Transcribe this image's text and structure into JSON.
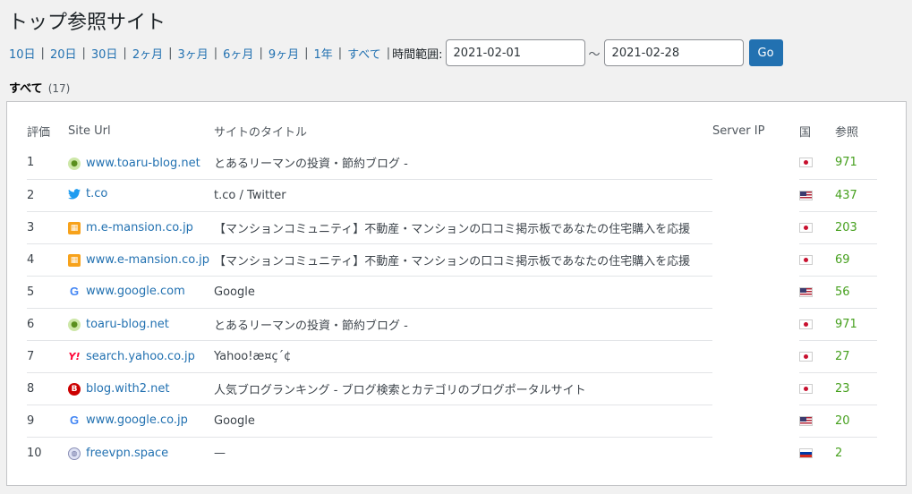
{
  "page_title": "トップ参照サイト",
  "filters": [
    {
      "label": "10日"
    },
    {
      "label": "20日"
    },
    {
      "label": "30日"
    },
    {
      "label": "2ヶ月"
    },
    {
      "label": "3ヶ月"
    },
    {
      "label": "6ヶ月"
    },
    {
      "label": "9ヶ月"
    },
    {
      "label": "1年"
    },
    {
      "label": "すべて"
    }
  ],
  "range_label": "時間範囲:",
  "date_from": "2021-02-01",
  "date_to": "2021-02-28",
  "tilde": "～",
  "go_label": "Go",
  "subsub": {
    "label": "すべて",
    "count": "(17)"
  },
  "columns": {
    "rank": "評価",
    "url": "Site Url",
    "title": "サイトのタイトル",
    "ip": "Server IP",
    "country": "国",
    "views": "参照"
  },
  "rows": [
    {
      "rank": "1",
      "url": "www.toaru-blog.net",
      "icon": "toaru-blog-icon",
      "title": "とあるリーマンの投資・節約ブログ -",
      "ip": "",
      "country": "jp",
      "views": "971"
    },
    {
      "rank": "2",
      "url": "t.co",
      "icon": "twitter-icon",
      "title": "t.co / Twitter",
      "ip": "",
      "country": "us",
      "views": "437"
    },
    {
      "rank": "3",
      "url": "m.e-mansion.co.jp",
      "icon": "e-mansion-icon",
      "title": "【マンションコミュニティ】不動産・マンションの口コミ掲示板であなたの住宅購入を応援",
      "ip": "",
      "country": "jp",
      "views": "203"
    },
    {
      "rank": "4",
      "url": "www.e-mansion.co.jp",
      "icon": "e-mansion-icon",
      "title": "【マンションコミュニティ】不動産・マンションの口コミ掲示板であなたの住宅購入を応援",
      "ip": "",
      "country": "jp",
      "views": "69"
    },
    {
      "rank": "5",
      "url": "www.google.com",
      "icon": "google-icon",
      "title": "Google",
      "ip": "",
      "country": "us",
      "views": "56"
    },
    {
      "rank": "6",
      "url": "toaru-blog.net",
      "icon": "toaru-blog-icon",
      "title": "とあるリーマンの投資・節約ブログ -",
      "ip": "",
      "country": "jp",
      "views": "971"
    },
    {
      "rank": "7",
      "url": "search.yahoo.co.jp",
      "icon": "yahoo-icon",
      "title": "Yahoo!æ¤ç´¢",
      "ip": "",
      "country": "jp",
      "views": "27"
    },
    {
      "rank": "8",
      "url": "blog.with2.net",
      "icon": "blog-ranking-icon",
      "title": "人気ブログランキング - ブログ検索とカテゴリのブログポータルサイト",
      "ip": "",
      "country": "jp",
      "views": "23"
    },
    {
      "rank": "9",
      "url": "www.google.co.jp",
      "icon": "google-icon",
      "title": "Google",
      "ip": "",
      "country": "us",
      "views": "20"
    },
    {
      "rank": "10",
      "url": "freevpn.space",
      "icon": "globe-icon",
      "title": "—",
      "ip": "",
      "country": "ru",
      "views": "2"
    }
  ]
}
